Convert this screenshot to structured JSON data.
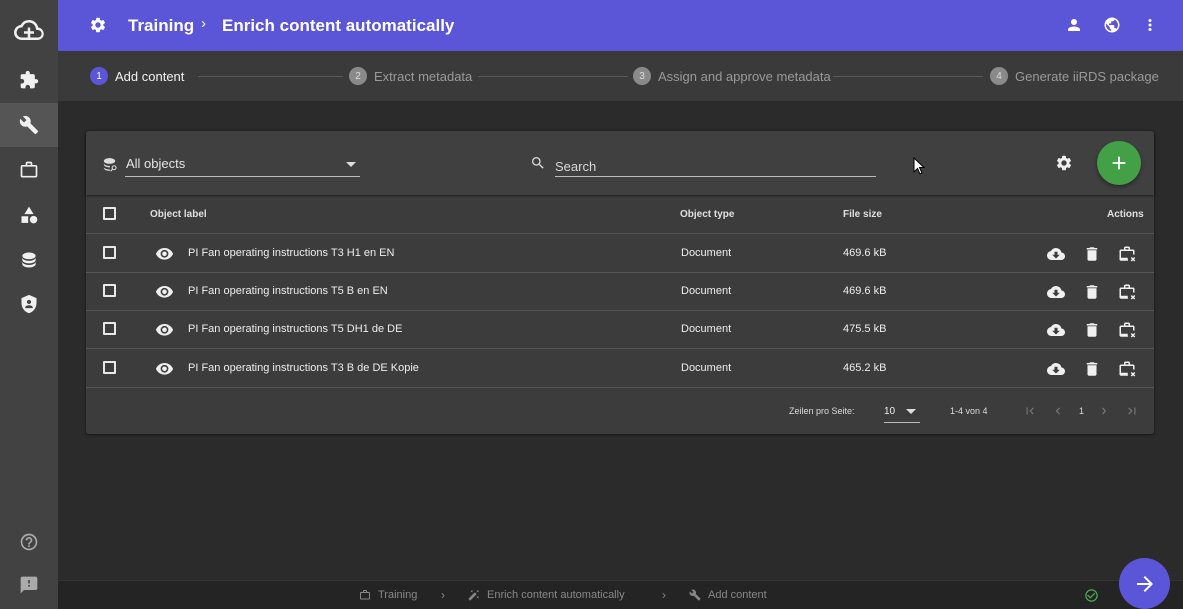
{
  "header": {
    "crumb_root": "Training",
    "crumb_separator": "›",
    "crumb_current": "Enrich content automatically",
    "icons": [
      "user-icon",
      "globe-icon",
      "more-vert-icon"
    ],
    "colors": {
      "header_bg": "#5b55d8",
      "accent": "#5b55d8"
    }
  },
  "sidebar": {
    "items": [
      {
        "name": "cloud-add-icon"
      },
      {
        "name": "puzzle-icon"
      },
      {
        "name": "wrench-icon",
        "active": true
      },
      {
        "name": "briefcase-icon"
      },
      {
        "name": "shapes-icon"
      },
      {
        "name": "database-icon"
      },
      {
        "name": "shield-user-icon"
      },
      {
        "name": "help-icon"
      },
      {
        "name": "feedback-icon"
      }
    ]
  },
  "stepper": {
    "steps": [
      {
        "num": "1",
        "label": "Add content",
        "active": true
      },
      {
        "num": "2",
        "label": "Extract metadata"
      },
      {
        "num": "3",
        "label": "Assign and approve metadata"
      },
      {
        "num": "4",
        "label": "Generate iiRDS package"
      }
    ]
  },
  "toolbar": {
    "filter_value": "All objects",
    "search_placeholder": "Search",
    "add_color": "#43a047"
  },
  "table": {
    "columns": {
      "label": "Object label",
      "type": "Object type",
      "size": "File size",
      "actions": "Actions"
    },
    "rows": [
      {
        "label": "PI Fan operating instructions T3 H1 en EN",
        "type": "Document",
        "size": "469.6 kB"
      },
      {
        "label": "PI Fan operating instructions T5 B en EN",
        "type": "Document",
        "size": "469.6 kB"
      },
      {
        "label": "PI Fan operating instructions T5 DH1 de DE",
        "type": "Document",
        "size": "475.5 kB"
      },
      {
        "label": "PI Fan operating instructions T3 B de DE Kopie",
        "type": "Document",
        "size": "465.2 kB"
      }
    ],
    "row_actions": [
      "download-icon",
      "delete-icon",
      "remove-from-package-icon"
    ]
  },
  "pagination": {
    "rows_per_page_label": "Zeilen pro Seite:",
    "rows_per_page": "10",
    "range": "1-4 von 4",
    "page": "1"
  },
  "bottombar": {
    "items": [
      {
        "label": "Training",
        "icon": "briefcase-icon"
      },
      {
        "label": "Enrich content automatically",
        "icon": "magic-wand-icon"
      },
      {
        "label": "Add content",
        "icon": "wrench-icon"
      }
    ],
    "separator": "›",
    "status": "check-circle-icon"
  }
}
